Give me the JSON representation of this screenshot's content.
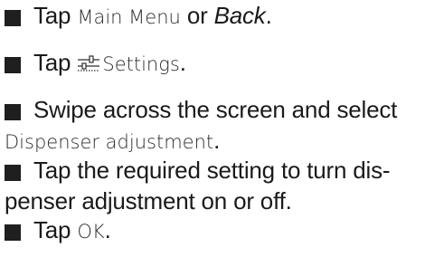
{
  "steps": [
    {
      "tap": "Tap",
      "main_menu": "Main Menu",
      "or": "or",
      "back": "Back",
      "end": "."
    },
    {
      "tap": "Tap",
      "icon": "settings-sliders-icon",
      "settings": "Settings",
      "end": "."
    },
    {
      "line1": "Swipe across the screen and select",
      "dispenser_adjustment": "Dispenser adjustment",
      "end": "."
    },
    {
      "line1": "Tap the required setting to turn dis-",
      "line2": "penser adjustment on or off."
    },
    {
      "tap": "Tap",
      "ok": "OK",
      "end": "."
    }
  ],
  "colors": {
    "text": "#1a1a1a",
    "ui_text": "#2e2e2e",
    "bullet": "#1f1f1f"
  }
}
